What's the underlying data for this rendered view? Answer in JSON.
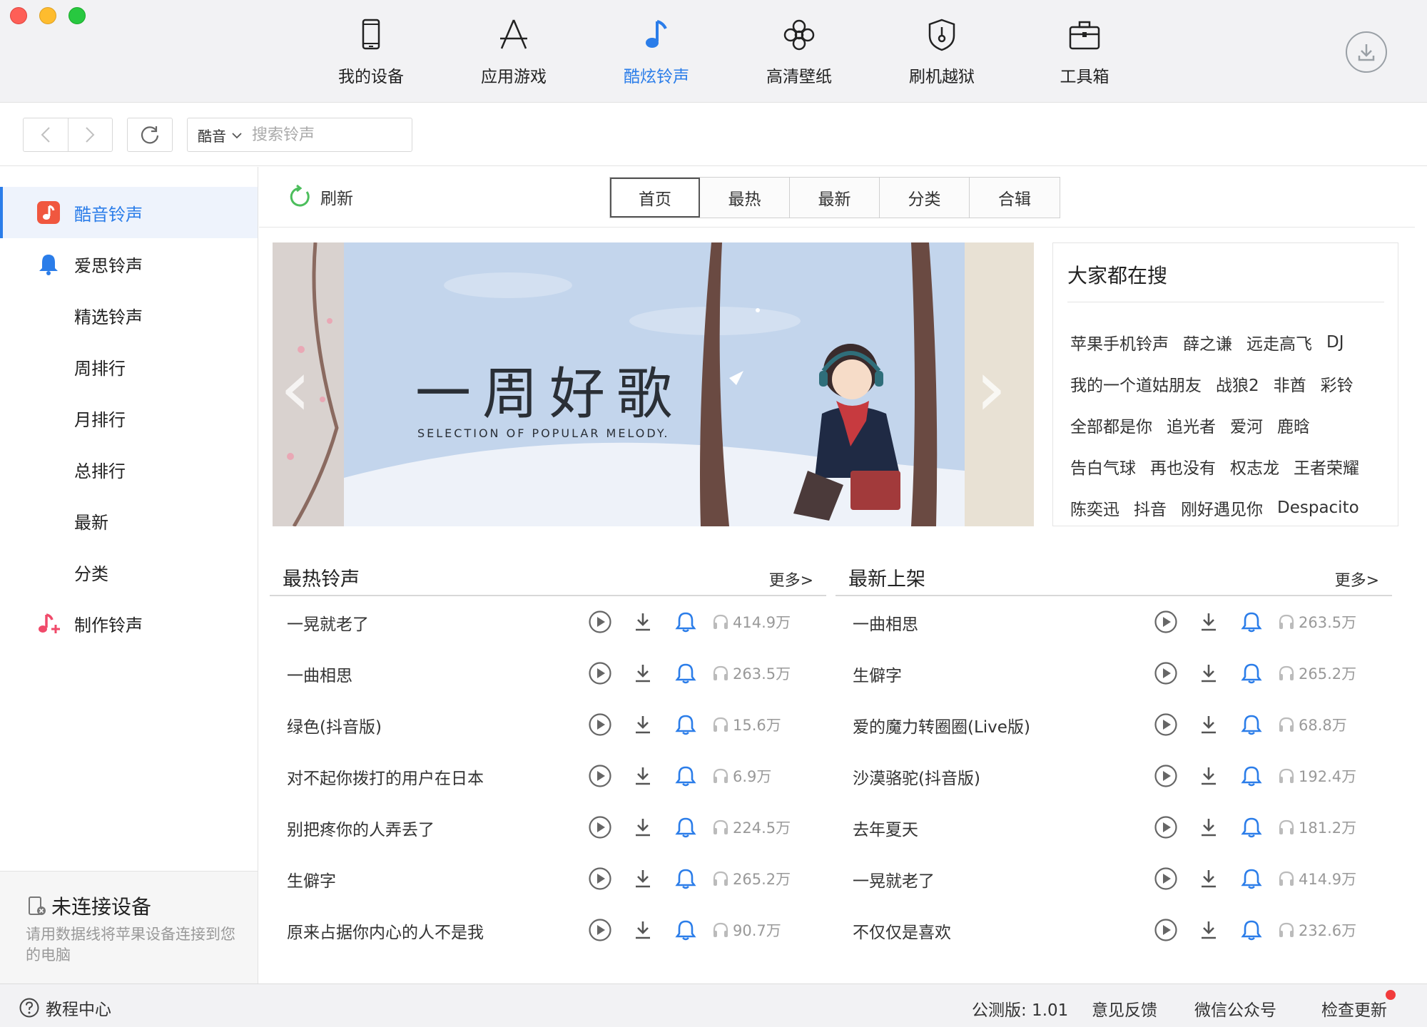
{
  "topnav": {
    "tabs": [
      {
        "label": "我的设备",
        "icon": "phone-icon",
        "active": false
      },
      {
        "label": "应用游戏",
        "icon": "app-store-icon",
        "active": false
      },
      {
        "label": "酷炫铃声",
        "icon": "music-note-icon",
        "active": true
      },
      {
        "label": "高清壁纸",
        "icon": "flower-icon",
        "active": false
      },
      {
        "label": "刷机越狱",
        "icon": "shield-key-icon",
        "active": false
      },
      {
        "label": "工具箱",
        "icon": "toolbox-icon",
        "active": false
      }
    ],
    "download_icon": "download-circle-icon",
    "accent": "#2b7de9"
  },
  "toolbar": {
    "search_source": "酷音",
    "search_placeholder": "搜索铃声"
  },
  "sidebar": {
    "items": [
      {
        "label": "酷音铃声",
        "icon": "kuyin-icon",
        "active": true
      },
      {
        "label": "爱思铃声",
        "icon": "bell-icon",
        "active": false
      },
      {
        "label": "精选铃声"
      },
      {
        "label": "周排行"
      },
      {
        "label": "月排行"
      },
      {
        "label": "总排行"
      },
      {
        "label": "最新"
      },
      {
        "label": "分类"
      },
      {
        "label": "制作铃声",
        "icon": "make-ringtone-icon"
      }
    ],
    "device": {
      "title": "未连接设备",
      "desc": "请用数据线将苹果设备连接到您的电脑"
    }
  },
  "main": {
    "refresh_label": "刷新",
    "tabs": [
      "首页",
      "最热",
      "最新",
      "分类",
      "合辑"
    ],
    "active_tab": "首页",
    "banner": {
      "title": "一周好歌",
      "subtitle": "SELECTION OF POPULAR MELODY."
    },
    "hot_search": {
      "title": "大家都在搜",
      "rows": [
        [
          "苹果手机铃声",
          "薛之谦",
          "远走高飞",
          "DJ"
        ],
        [
          "我的一个道姑朋友",
          "战狼2",
          "非酋",
          "彩铃"
        ],
        [
          "全部都是你",
          "追光者",
          "爱河",
          "鹿晗"
        ],
        [
          "告白气球",
          "再也没有",
          "权志龙",
          "王者荣耀"
        ],
        [
          "陈奕迅",
          "抖音",
          "刚好遇见你",
          "Despacito"
        ]
      ]
    },
    "hot_list": {
      "title": "最热铃声",
      "more": "更多>",
      "items": [
        {
          "name": "一晃就老了",
          "count": "414.9万"
        },
        {
          "name": "一曲相思",
          "count": "263.5万"
        },
        {
          "name": "绿色(抖音版)",
          "count": "15.6万"
        },
        {
          "name": "对不起你拨打的用户在日本",
          "count": "6.9万"
        },
        {
          "name": "别把疼你的人弄丢了",
          "count": "224.5万"
        },
        {
          "name": "生僻字",
          "count": "265.2万"
        },
        {
          "name": "原来占据你内心的人不是我",
          "count": "90.7万"
        }
      ]
    },
    "new_list": {
      "title": "最新上架",
      "more": "更多>",
      "items": [
        {
          "name": "一曲相思",
          "count": "263.5万"
        },
        {
          "name": "生僻字",
          "count": "265.2万"
        },
        {
          "name": "爱的魔力转圈圈(Live版)",
          "count": "68.8万"
        },
        {
          "name": "沙漠骆驼(抖音版)",
          "count": "192.4万"
        },
        {
          "name": "去年夏天",
          "count": "181.2万"
        },
        {
          "name": "一晃就老了",
          "count": "414.9万"
        },
        {
          "name": "不仅仅是喜欢",
          "count": "232.6万"
        }
      ]
    }
  },
  "statusbar": {
    "help": "教程中心",
    "version": "公测版: 1.01",
    "feedback": "意见反馈",
    "wechat": "微信公众号",
    "update": "检查更新"
  }
}
